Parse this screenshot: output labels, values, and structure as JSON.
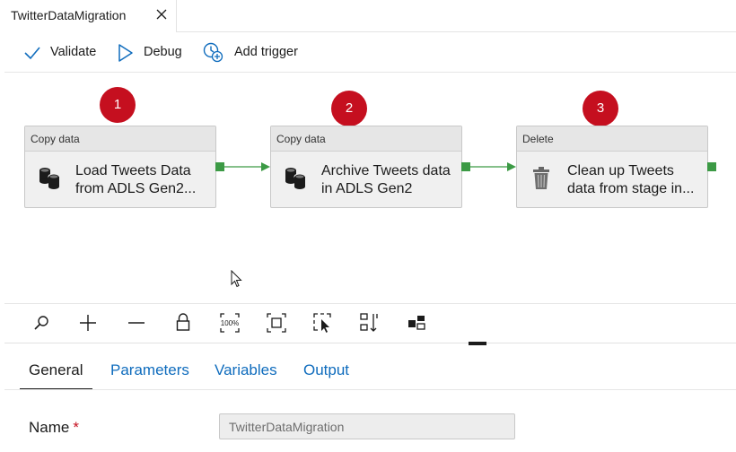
{
  "tab": {
    "title": "TwitterDataMigration"
  },
  "toolbar": {
    "validate_label": "Validate",
    "debug_label": "Debug",
    "add_trigger_label": "Add trigger"
  },
  "activities": [
    {
      "step": "1",
      "type": "Copy data",
      "name_line1": "Load Tweets Data",
      "name_line2": "from ADLS Gen2...",
      "icon": "copy-data-icon"
    },
    {
      "step": "2",
      "type": "Copy data",
      "name_line1": "Archive Tweets data",
      "name_line2": "in ADLS Gen2",
      "icon": "copy-data-icon"
    },
    {
      "step": "3",
      "type": "Delete",
      "name_line1": "Clean up Tweets",
      "name_line2": "data from stage in...",
      "icon": "trash-icon"
    }
  ],
  "canvas_tools": [
    "search-icon",
    "zoom-in-icon",
    "zoom-out-icon",
    "lock-icon",
    "zoom-100-icon",
    "fit-to-screen-icon",
    "select-icon",
    "auto-align-icon",
    "layout-icon"
  ],
  "properties": {
    "tabs": [
      "General",
      "Parameters",
      "Variables",
      "Output"
    ],
    "active_tab": "General",
    "name_label": "Name",
    "required_mark": "*",
    "name_value": "TwitterDataMigration"
  },
  "colors": {
    "accent": "#0f6cbd",
    "badge": "#c50f1f",
    "success_port": "#3c9a45",
    "text": "#1b1b1b"
  }
}
